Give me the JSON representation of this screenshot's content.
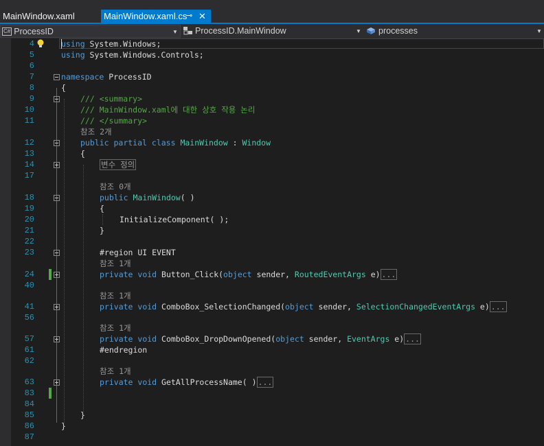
{
  "tabs": {
    "inactive": "MainWindow.xaml",
    "active": "MainWindow.xaml.cs",
    "pin_glyph": "⊸",
    "close_glyph": "✕"
  },
  "navbar": {
    "project": "ProcessID",
    "project_badge": "C#",
    "type": "ProcessID.MainWindow",
    "member": "processes"
  },
  "lines": [
    {
      "n": "4"
    },
    {
      "n": "5"
    },
    {
      "n": "6"
    },
    {
      "n": "7"
    },
    {
      "n": "8"
    },
    {
      "n": "9"
    },
    {
      "n": "10"
    },
    {
      "n": "11"
    },
    {
      "n": ""
    },
    {
      "n": "12"
    },
    {
      "n": "13"
    },
    {
      "n": "14"
    },
    {
      "n": "17"
    },
    {
      "n": ""
    },
    {
      "n": "18"
    },
    {
      "n": "19"
    },
    {
      "n": "20"
    },
    {
      "n": "21"
    },
    {
      "n": "22"
    },
    {
      "n": "23"
    },
    {
      "n": ""
    },
    {
      "n": "24"
    },
    {
      "n": "40"
    },
    {
      "n": ""
    },
    {
      "n": "41"
    },
    {
      "n": "56"
    },
    {
      "n": ""
    },
    {
      "n": "57"
    },
    {
      "n": "61"
    },
    {
      "n": "62"
    },
    {
      "n": ""
    },
    {
      "n": "63"
    },
    {
      "n": "83"
    },
    {
      "n": "84"
    },
    {
      "n": "85"
    },
    {
      "n": "86"
    },
    {
      "n": "87"
    }
  ],
  "code": {
    "l4": {
      "kw": "using",
      "rest": " System.Windows;"
    },
    "l5": {
      "kw": "using",
      "rest": " System.Windows.Controls;"
    },
    "l7": {
      "kw": "namespace",
      "rest": " ProcessID"
    },
    "l8": "{",
    "l9": "/// <summary>",
    "l10": "/// MainWindow.xaml에 대한 상호 작용 논리",
    "l11": "/// </summary>",
    "lens_class": "참조 2개",
    "l12": {
      "kw1": "public",
      "kw2": "partial",
      "kw3": "class",
      "name": "MainWindow",
      "sep": " : ",
      "base": "Window"
    },
    "l13": "{",
    "l14_region": "변수 정의",
    "lens_ctor": "참조 0개",
    "l18": {
      "kw": "public",
      "name": "MainWindow",
      "rest": "( )"
    },
    "l19": "{",
    "l20": "InitializeComponent( );",
    "l21": "}",
    "l23": "#region UI EVENT",
    "lens_btn": "참조 1개",
    "l24": {
      "kw1": "private",
      "kw2": "void",
      "name": " Button_Click(",
      "p1": "object",
      "p1n": " sender, ",
      "p2": "RoutedEventArgs",
      "p2n": " e)",
      "ellipsis": "..."
    },
    "lens_combo1": "참조 1개",
    "l41": {
      "kw1": "private",
      "kw2": "void",
      "name": " ComboBox_SelectionChanged(",
      "p1": "object",
      "p1n": " sender, ",
      "p2": "SelectionChangedEventArgs",
      "p2n": " e)",
      "ellipsis": "..."
    },
    "lens_combo2": "참조 1개",
    "l57": {
      "kw1": "private",
      "kw2": "void",
      "name": " ComboBox_DropDownOpened(",
      "p1": "object",
      "p1n": " sender, ",
      "p2": "EventArgs",
      "p2n": " e)",
      "ellipsis": "..."
    },
    "l61": "#endregion",
    "lens_getall": "참조 1개",
    "l63": {
      "kw1": "private",
      "kw2": "void",
      "name": " GetAllProcessName( )",
      "ellipsis": "..."
    },
    "l85": "}",
    "l86": "}"
  },
  "colors": {
    "accent": "#007acc",
    "keyword": "#569cd6",
    "type": "#4ec9b0",
    "comment": "#57a64a",
    "line_number": "#2b91af",
    "background": "#1e1e1e"
  }
}
